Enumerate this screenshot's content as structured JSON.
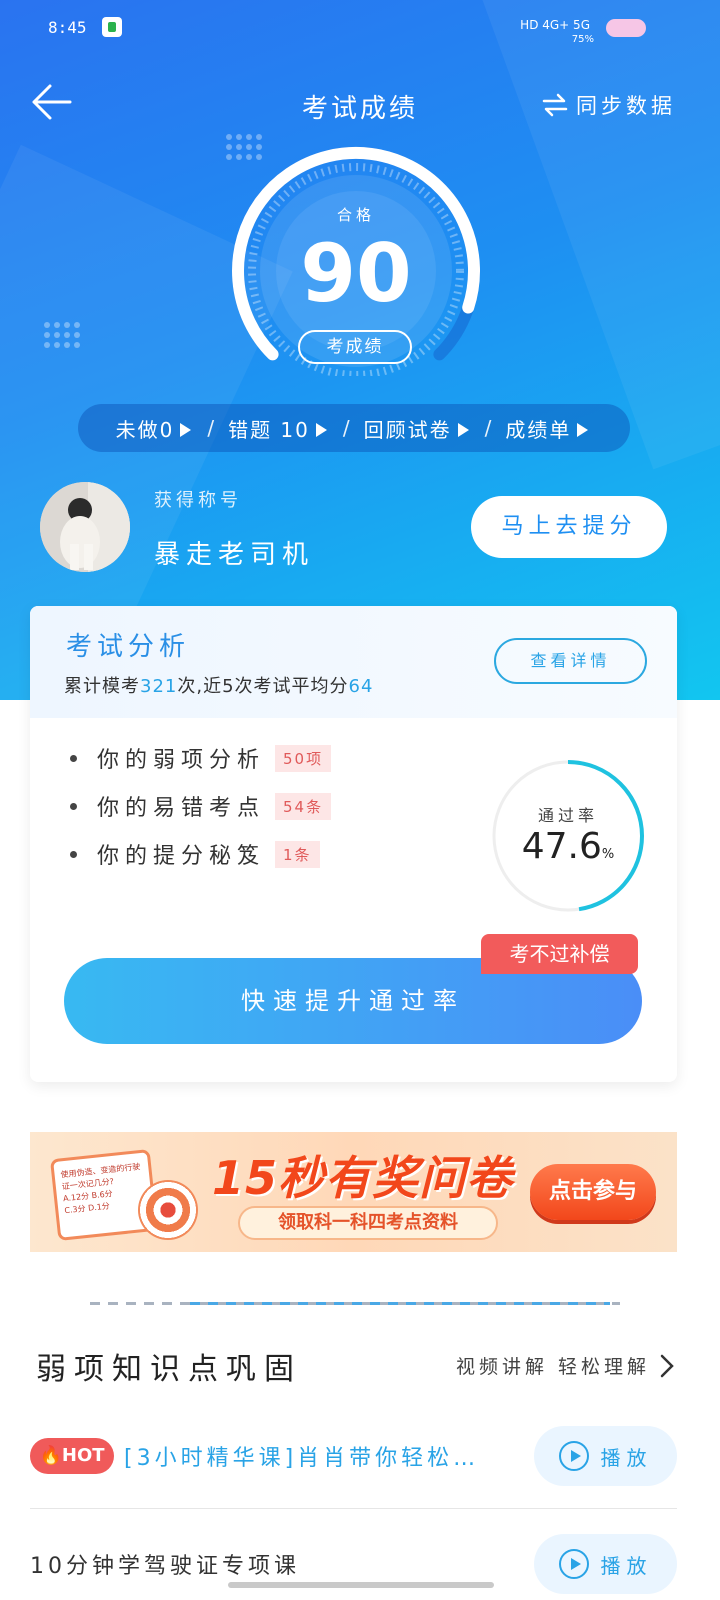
{
  "status_bar": {
    "time": "8:45",
    "network": "HD 4G+ 5G",
    "battery": "75%"
  },
  "header": {
    "title": "考试成绩",
    "sync_label": "同步数据"
  },
  "gauge": {
    "status": "合格",
    "score": "90",
    "tag": "考成绩",
    "score_fraction": 0.9
  },
  "quick_links": [
    {
      "label": "未做0"
    },
    {
      "label": "错题 10"
    },
    {
      "label": "回顾试卷"
    },
    {
      "label": "成绩单"
    }
  ],
  "profile": {
    "nick_label": "获得称号",
    "nickname": "暴走老司机",
    "improve_button": "马上去提分"
  },
  "analysis": {
    "title": "考试分析",
    "sub_prefix": "累计模考",
    "total_count": "321",
    "sub_mid": "次,近5次考试平均分",
    "avg_score": "64",
    "detail_button": "查看详情",
    "items": [
      {
        "label": "你的弱项分析",
        "badge": "50项"
      },
      {
        "label": "你的易错考点",
        "badge": "54条"
      },
      {
        "label": "你的提分秘笈",
        "badge": "1条"
      }
    ],
    "pass_rate_label": "通过率",
    "pass_rate_value": "47.6",
    "pass_rate_unit": "%",
    "pass_rate_fraction": 0.476,
    "compensation_tag": "考不过补偿",
    "boost_button": "快速提升通过率"
  },
  "banner": {
    "headline": "15秒有奖问卷",
    "subline": "领取科一科四考点资料",
    "cta": "点击参与",
    "paper_text": "使用伪造、变造的行驶证一次记几分?",
    "paper_options": [
      "A.12分",
      "B.6分",
      "C.3分",
      "D.1分"
    ]
  },
  "weak_section": {
    "title": "弱项知识点巩固",
    "more_label": "视频讲解 轻松理解"
  },
  "courses": [
    {
      "hot": "HOT",
      "title": "[3小时精华课]肖肖带你轻松…",
      "play": "播放"
    },
    {
      "title": "10分钟学驾驶证专项课",
      "play": "播放"
    }
  ],
  "colors": {
    "accent": "#29a3e6",
    "hero_start": "#2a73f0",
    "hero_end": "#12c6f0",
    "alert": "#f25b5b"
  }
}
